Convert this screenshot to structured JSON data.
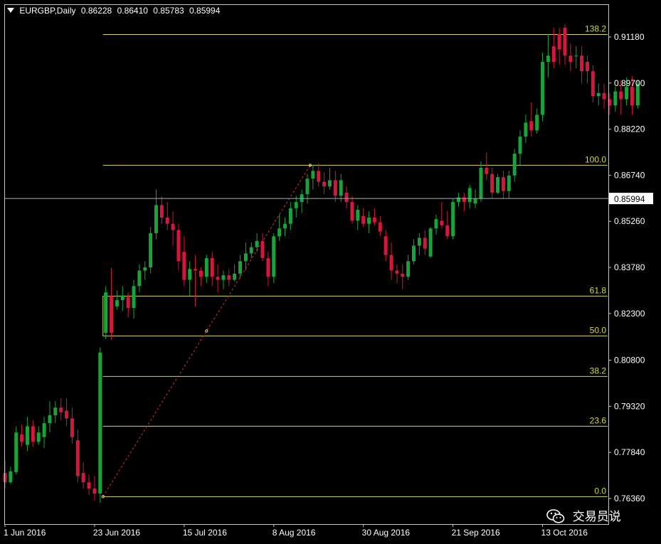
{
  "header": {
    "symbol_timeframe": "EURGBP,Daily",
    "open": "0.86228",
    "high": "0.86410",
    "low": "0.85783",
    "close": "0.85994"
  },
  "watermark": {
    "text": "交易员说",
    "icon": "wechat-icon"
  },
  "colors": {
    "background": "#000000",
    "bull": "#1aa33a",
    "bear": "#d3183c",
    "fib": "#d8d84a",
    "trend": "#d63030",
    "price_line": "#9ab0c4",
    "axis_text": "#ffffff"
  },
  "chart_data": {
    "type": "candlestick",
    "symbol": "EURGBP",
    "timeframe": "Daily",
    "current_price": 0.85994,
    "y_ticks": [
      "0.91180",
      "0.89700",
      "0.88220",
      "0.86740",
      "0.85260",
      "0.83780",
      "0.82300",
      "0.80800",
      "0.79320",
      "0.77840",
      "0.76360"
    ],
    "y_range": [
      0.7605,
      0.9185
    ],
    "x_ticks": [
      "1 Jun 2016",
      "23 Jun 2016",
      "15 Jul 2016",
      "8 Aug 2016",
      "30 Aug 2016",
      "21 Sep 2016",
      "13 Oct 2016"
    ],
    "x_tick_bars": [
      0,
      16,
      32,
      48,
      64,
      80,
      96
    ],
    "fibonacci": [
      {
        "level": "138.2",
        "price": 0.9126
      },
      {
        "level": "100.0",
        "price": 0.8706
      },
      {
        "level": "61.8",
        "price": 0.8286
      },
      {
        "level": "50.0",
        "price": 0.8158
      },
      {
        "level": "38.2",
        "price": 0.8028
      },
      {
        "level": "23.6",
        "price": 0.7868
      },
      {
        "level": "0.0",
        "price": 0.7642
      }
    ],
    "fib_start_bar": 17.5,
    "fib_end_bar": 105.5,
    "trendline": {
      "from_bar": 17.5,
      "from_price": 0.7642,
      "to_bar": 54.5,
      "to_price": 0.8706
    },
    "candles": [
      [
        0.7718,
        0.7758,
        0.7668,
        0.7688
      ],
      [
        0.7688,
        0.7738,
        0.7683,
        0.7723
      ],
      [
        0.7721,
        0.7868,
        0.7713,
        0.7848
      ],
      [
        0.7842,
        0.7872,
        0.7802,
        0.7818
      ],
      [
        0.7808,
        0.7898,
        0.7788,
        0.7868
      ],
      [
        0.7868,
        0.7888,
        0.7803,
        0.7818
      ],
      [
        0.7818,
        0.7868,
        0.7808,
        0.7848
      ],
      [
        0.7833,
        0.7898,
        0.7798,
        0.7878
      ],
      [
        0.7878,
        0.7948,
        0.7848,
        0.7903
      ],
      [
        0.7903,
        0.7948,
        0.7878,
        0.7928
      ],
      [
        0.7928,
        0.7958,
        0.7888,
        0.7913
      ],
      [
        0.7918,
        0.7958,
        0.7868,
        0.7893
      ],
      [
        0.7893,
        0.7928,
        0.7813,
        0.7833
      ],
      [
        0.7823,
        0.7858,
        0.7688,
        0.7708
      ],
      [
        0.7718,
        0.7752,
        0.7668,
        0.7688
      ],
      [
        0.7688,
        0.7713,
        0.7648,
        0.7668
      ],
      [
        0.7668,
        0.7708,
        0.7628,
        0.7652
      ],
      [
        0.7652,
        0.8121,
        0.7622,
        0.8105
      ],
      [
        0.8168,
        0.8318,
        0.8148,
        0.8298
      ],
      [
        0.8286,
        0.8376,
        0.8146,
        0.8168
      ],
      [
        0.8253,
        0.8303,
        0.8243,
        0.8273
      ],
      [
        0.8273,
        0.8318,
        0.8238,
        0.8288
      ],
      [
        0.8283,
        0.8298,
        0.8218,
        0.8248
      ],
      [
        0.8248,
        0.8338,
        0.8213,
        0.8318
      ],
      [
        0.8318,
        0.8388,
        0.8298,
        0.8368
      ],
      [
        0.8368,
        0.8398,
        0.8338,
        0.8378
      ],
      [
        0.8378,
        0.8508,
        0.8358,
        0.8488
      ],
      [
        0.8488,
        0.8628,
        0.8468,
        0.8578
      ],
      [
        0.8578,
        0.8606,
        0.8518,
        0.8538
      ],
      [
        0.8538,
        0.8588,
        0.8498,
        0.8518
      ],
      [
        0.8518,
        0.8558,
        0.8448,
        0.8498
      ],
      [
        0.8498,
        0.8518,
        0.8368,
        0.8398
      ],
      [
        0.8428,
        0.8478,
        0.8318,
        0.8338
      ],
      [
        0.8338,
        0.8398,
        0.8288,
        0.8373
      ],
      [
        0.8373,
        0.8418,
        0.8253,
        0.8368
      ],
      [
        0.8368,
        0.8378,
        0.8318,
        0.8348
      ],
      [
        0.8348,
        0.8418,
        0.8328,
        0.8408
      ],
      [
        0.8408,
        0.8428,
        0.8318,
        0.8348
      ],
      [
        0.8348,
        0.8388,
        0.8298,
        0.8338
      ],
      [
        0.8338,
        0.8368,
        0.8308,
        0.8353
      ],
      [
        0.8353,
        0.8373,
        0.8318,
        0.8338
      ],
      [
        0.8338,
        0.8388,
        0.8333,
        0.8358
      ],
      [
        0.8358,
        0.8418,
        0.8343,
        0.8398
      ],
      [
        0.8398,
        0.8458,
        0.8368,
        0.8423
      ],
      [
        0.8423,
        0.8458,
        0.8408,
        0.8443
      ],
      [
        0.8443,
        0.8488,
        0.8428,
        0.8463
      ],
      [
        0.8463,
        0.8488,
        0.8398,
        0.8408
      ],
      [
        0.8408,
        0.8428,
        0.8318,
        0.8348
      ],
      [
        0.8348,
        0.8488,
        0.8328,
        0.8478
      ],
      [
        0.8478,
        0.8548,
        0.8463,
        0.8503
      ],
      [
        0.8503,
        0.8538,
        0.8478,
        0.8518
      ],
      [
        0.8518,
        0.8588,
        0.8498,
        0.8568
      ],
      [
        0.8568,
        0.8608,
        0.8538,
        0.8588
      ],
      [
        0.8588,
        0.8628,
        0.8553,
        0.8613
      ],
      [
        0.8613,
        0.8678,
        0.8583,
        0.8663
      ],
      [
        0.8663,
        0.8708,
        0.8628,
        0.8688
      ],
      [
        0.8688,
        0.8713,
        0.8638,
        0.8653
      ],
      [
        0.8653,
        0.8683,
        0.8613,
        0.8638
      ],
      [
        0.8638,
        0.8698,
        0.8628,
        0.8658
      ],
      [
        0.8658,
        0.8688,
        0.8588,
        0.8608
      ],
      [
        0.8608,
        0.8678,
        0.8588,
        0.8658
      ],
      [
        0.8618,
        0.8638,
        0.8568,
        0.8588
      ],
      [
        0.8588,
        0.8608,
        0.8518,
        0.8528
      ],
      [
        0.8528,
        0.8578,
        0.8498,
        0.8563
      ],
      [
        0.8543,
        0.8568,
        0.8508,
        0.8518
      ],
      [
        0.8518,
        0.8558,
        0.8488,
        0.8538
      ],
      [
        0.8538,
        0.8568,
        0.8513,
        0.8523
      ],
      [
        0.8523,
        0.8543,
        0.8478,
        0.8493
      ],
      [
        0.8478,
        0.8498,
        0.8398,
        0.8418
      ],
      [
        0.8418,
        0.8458,
        0.8338,
        0.8368
      ],
      [
        0.8368,
        0.8388,
        0.8328,
        0.8358
      ],
      [
        0.8358,
        0.8388,
        0.8308,
        0.8348
      ],
      [
        0.8348,
        0.8418,
        0.8338,
        0.8398
      ],
      [
        0.8398,
        0.8468,
        0.8388,
        0.8448
      ],
      [
        0.8448,
        0.8488,
        0.8418,
        0.8473
      ],
      [
        0.8473,
        0.8498,
        0.8418,
        0.8438
      ],
      [
        0.8413,
        0.8508,
        0.8408,
        0.8503
      ],
      [
        0.8503,
        0.8548,
        0.8483,
        0.8533
      ],
      [
        0.8528,
        0.8588,
        0.8503,
        0.8513
      ],
      [
        0.8513,
        0.8558,
        0.8468,
        0.8478
      ],
      [
        0.8478,
        0.8598,
        0.8468,
        0.8588
      ],
      [
        0.8588,
        0.8618,
        0.8573,
        0.8603
      ],
      [
        0.8603,
        0.8618,
        0.8558,
        0.8588
      ],
      [
        0.8588,
        0.8643,
        0.8568,
        0.8633
      ],
      [
        0.8583,
        0.8628,
        0.8568,
        0.8598
      ],
      [
        0.8598,
        0.8718,
        0.8588,
        0.8698
      ],
      [
        0.8698,
        0.8748,
        0.8658,
        0.8678
      ],
      [
        0.8678,
        0.8698,
        0.8598,
        0.8618
      ],
      [
        0.8618,
        0.8678,
        0.8613,
        0.8668
      ],
      [
        0.8668,
        0.8688,
        0.8598,
        0.8623
      ],
      [
        0.8623,
        0.8688,
        0.8598,
        0.8673
      ],
      [
        0.8673,
        0.8758,
        0.8653,
        0.8743
      ],
      [
        0.8743,
        0.8818,
        0.8703,
        0.8798
      ],
      [
        0.8798,
        0.8868,
        0.8778,
        0.8843
      ],
      [
        0.8848,
        0.8908,
        0.8798,
        0.8818
      ],
      [
        0.8818,
        0.8888,
        0.8808,
        0.8868
      ],
      [
        0.8868,
        0.9068,
        0.8848,
        0.9038
      ],
      [
        0.9038,
        0.9128,
        0.8988,
        0.9058
      ],
      [
        0.9088,
        0.9148,
        0.9018,
        0.9038
      ],
      [
        0.9128,
        0.9148,
        0.9028,
        0.9078
      ],
      [
        0.9148,
        0.9158,
        0.9028,
        0.9058
      ],
      [
        0.9058,
        0.9098,
        0.9008,
        0.9038
      ],
      [
        0.9058,
        0.9088,
        0.9018,
        0.9058
      ],
      [
        0.9058,
        0.9088,
        0.8968,
        0.9008
      ],
      [
        0.9038,
        0.9058,
        0.8968,
        0.9008
      ],
      [
        0.9008,
        0.9028,
        0.8908,
        0.8928
      ],
      [
        0.8928,
        0.8968,
        0.8898,
        0.8938
      ],
      [
        0.8938,
        0.8968,
        0.8888,
        0.8918
      ],
      [
        0.8918,
        0.8938,
        0.8868,
        0.8898
      ],
      [
        0.8898,
        0.8958,
        0.8878,
        0.8943
      ],
      [
        0.8943,
        0.8978,
        0.8868,
        0.8918
      ],
      [
        0.8918,
        0.8988,
        0.8898,
        0.8958
      ],
      [
        0.8958,
        0.8993,
        0.8868,
        0.8898
      ],
      [
        0.8898,
        0.8978,
        0.8888,
        0.8968
      ]
    ]
  }
}
